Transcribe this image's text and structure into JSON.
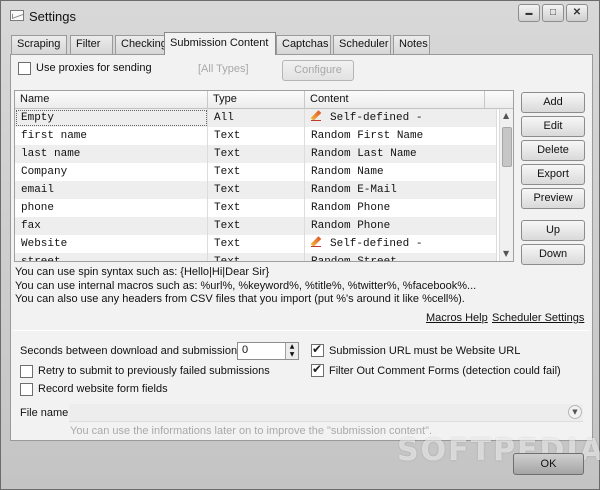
{
  "window": {
    "title": "Settings"
  },
  "titlebar_buttons": {
    "minimize": "▬",
    "maximize": "□",
    "close": "✕"
  },
  "tabs": [
    {
      "label": "Scraping"
    },
    {
      "label": "Filter"
    },
    {
      "label": "Checking"
    },
    {
      "label": "Submission Content",
      "active": true
    },
    {
      "label": "Captchas"
    },
    {
      "label": "Scheduler"
    },
    {
      "label": "Notes"
    }
  ],
  "proxies": {
    "label": "Use proxies for sending",
    "checked": false,
    "types": "[All Types]",
    "configure": "Configure"
  },
  "table": {
    "columns": [
      "Name",
      "Type",
      "Content"
    ],
    "rows": [
      {
        "name": "Empty",
        "type": "All",
        "content": "Self-defined -",
        "icon": "pencil-icon"
      },
      {
        "name": "first name",
        "type": "Text",
        "content": "Random First Name"
      },
      {
        "name": "last name",
        "type": "Text",
        "content": "Random Last Name"
      },
      {
        "name": "Company",
        "type": "Text",
        "content": "Random Name"
      },
      {
        "name": "email",
        "type": "Text",
        "content": "Random E-Mail"
      },
      {
        "name": "phone",
        "type": "Text",
        "content": "Random Phone"
      },
      {
        "name": "fax",
        "type": "Text",
        "content": "Random Phone"
      },
      {
        "name": "Website",
        "type": "Text",
        "content": "Self-defined -",
        "icon": "pencil-icon"
      },
      {
        "name": "street",
        "type": "Text",
        "content": "Random Street"
      }
    ]
  },
  "side_buttons": {
    "add": "Add",
    "edit": "Edit",
    "delete": "Delete",
    "export": "Export",
    "preview": "Preview",
    "up": "Up",
    "down": "Down"
  },
  "info": {
    "line1": "You can use spin syntax such as: {Hello|Hi|Dear Sir}",
    "line2": "You can use internal macros such as: %url%, %keyword%, %title%, %twitter%, %facebook%...",
    "line3": "You can also use any headers from CSV files that you import (put %'s around it like %cell%)."
  },
  "links": {
    "macros_help": "Macros Help",
    "scheduler_settings": "Scheduler Settings"
  },
  "options": {
    "seconds_label": "Seconds between download and submission",
    "seconds_value": "0",
    "retry_label": "Retry to submit to previously failed submissions",
    "retry_checked": false,
    "record_label": "Record website form fields",
    "record_checked": false,
    "submission_url_label": "Submission URL must be Website URL",
    "submission_url_checked": true,
    "filter_label": "Filter Out Comment Forms (detection could fail)",
    "filter_checked": true
  },
  "file": {
    "label": "File name",
    "value": "",
    "hint": "You can use the informations later on to improve the \"submission content\"."
  },
  "footer": {
    "ok": "OK",
    "watermark": "SOFTPEDIA"
  }
}
